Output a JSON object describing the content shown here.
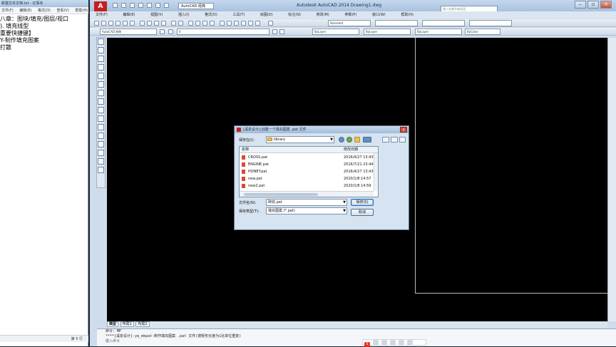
{
  "notepad": {
    "title": "新建文本文档.txt - 记事本",
    "menu": [
      "文件(F)",
      "编辑(E)",
      "格式(O)",
      "查看(V)",
      "帮助(H)"
    ],
    "lines": [
      "八章：图块/填充/图层/视口",
      "). 填充线型",
      "重要快捷键】",
      "Y-制作填充图案",
      "打散"
    ],
    "status": "第 5 行"
  },
  "cad": {
    "title": "Autodesk AutoCAD 2014    Drawing1.dwg",
    "workspace": "AutoCAD 经典",
    "help_placeholder": "键入关键字或短语",
    "menu": [
      "文件(F)",
      "编辑(E)",
      "视图(V)",
      "插入(I)",
      "格式(O)",
      "工具(T)",
      "绘图(D)",
      "标注(N)",
      "修改(M)",
      "参数(P)",
      "窗口(W)",
      "帮助(H)"
    ],
    "toolbar1": {
      "text_style": "Standard"
    },
    "toolbar2": {
      "workspace": "AutoCAD 经典",
      "layer": "0",
      "color": "ByLayer",
      "linetype": "ByLayer",
      "lineweight": "ByLayer",
      "plotstyle": "ByColor"
    },
    "layout_tabs": [
      "模型",
      "布局1",
      "布局2"
    ],
    "command": {
      "line1": "命令: MP",
      "line2": "****[溪泉设计]-yq_mkpat-制作填充图案 .pat 文件(按矩形长度为1比单位重复)",
      "prompt": "键入命令"
    }
  },
  "dialog": {
    "title": "[溪泉设计]-创建一个填充图案 .pat 文件",
    "close": "X",
    "save_in_label": "保存在(I):",
    "save_in_value": "library",
    "columns": {
      "name": "名称",
      "date": "修改日期"
    },
    "files": [
      {
        "name": "CROSS.pat",
        "date": "2016/4/27 13:43"
      },
      {
        "name": "ENGINE.pat",
        "date": "2016/7/21 23:44"
      },
      {
        "name": "HONEY.pat",
        "date": "2016/4/27 13:43"
      },
      {
        "name": "new.pat",
        "date": "2020/1/8 14:57"
      },
      {
        "name": "new2.pat",
        "date": "2020/1/8 14:59"
      }
    ],
    "filename_label": "文件名(N):",
    "filename_value": "砖纹.pat",
    "filetype_label": "保存类型(T):",
    "filetype_value": "填充图案 (*.pat)",
    "save_button": "保存(S)",
    "cancel_button": "取消"
  }
}
